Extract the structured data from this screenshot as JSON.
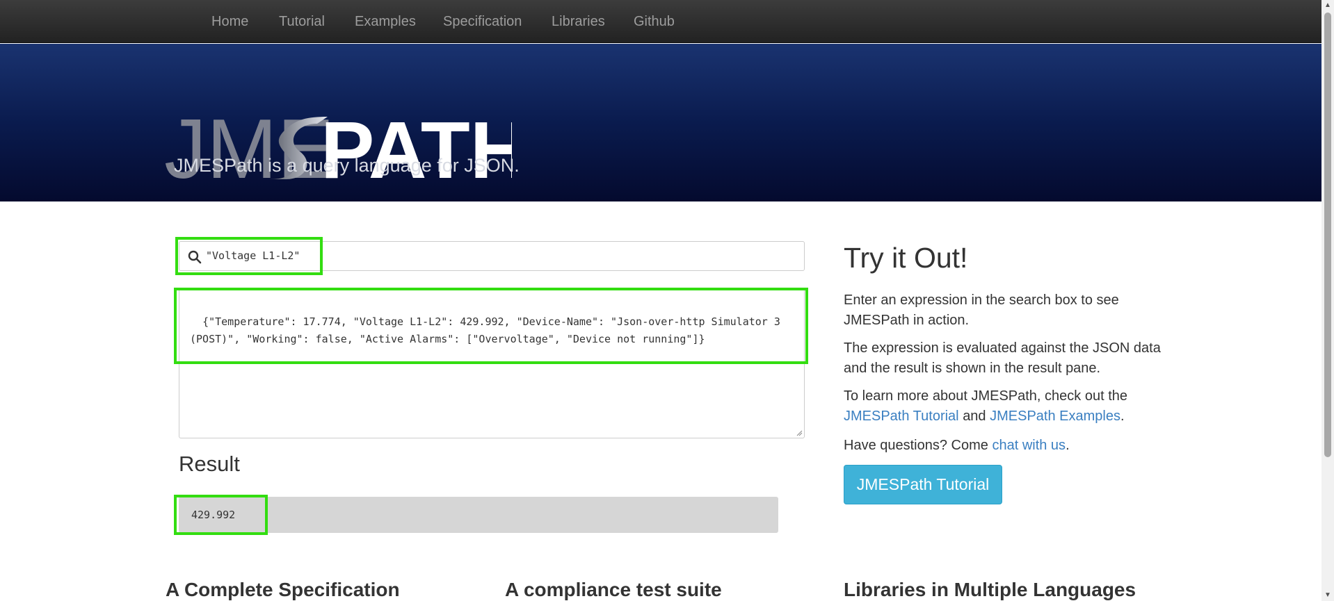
{
  "nav": {
    "items": [
      "Home",
      "Tutorial",
      "Examples",
      "Specification",
      "Libraries",
      "Github"
    ]
  },
  "header": {
    "logo_text_left": "JME",
    "logo_text_right": "PATH",
    "tagline": "JMESPath is a query language for JSON."
  },
  "search": {
    "icon": "search-icon",
    "value": "\"Voltage L1-L2\""
  },
  "json_input": {
    "value": "{\"Temperature\": 17.774, \"Voltage L1-L2\": 429.992, \"Device-Name\": \"Json-over-http Simulator 3 (POST)\", \"Working\": false, \"Active Alarms\": [\"Overvoltage\", \"Device not running\"]}"
  },
  "result": {
    "heading": "Result",
    "value": "429.992"
  },
  "sidebar": {
    "title": "Try it Out!",
    "p1": "Enter an expression in the search box to see JMESPath in action.",
    "p2": "The expression is evaluated against the JSON data and the result is shown in the result pane.",
    "p3_prefix": "To learn more about JMESPath, check out the",
    "p3_link1": "JMESPath Tutorial",
    "p3_and": "and",
    "p3_link2": "JMESPath Examples",
    "p3_suffix": ".",
    "p4_prefix": "Have questions? Come",
    "p4_link": "chat with us",
    "p4_suffix": ".",
    "button_label": "JMESPath Tutorial"
  },
  "features": {
    "headings": [
      "A Complete Specification",
      "A compliance test suite",
      "Libraries in Multiple Languages"
    ]
  },
  "colors": {
    "highlight": "#33dd11",
    "link": "#3a7fc1",
    "button": "#3fb2d8",
    "banner": "#0a1b4e"
  }
}
